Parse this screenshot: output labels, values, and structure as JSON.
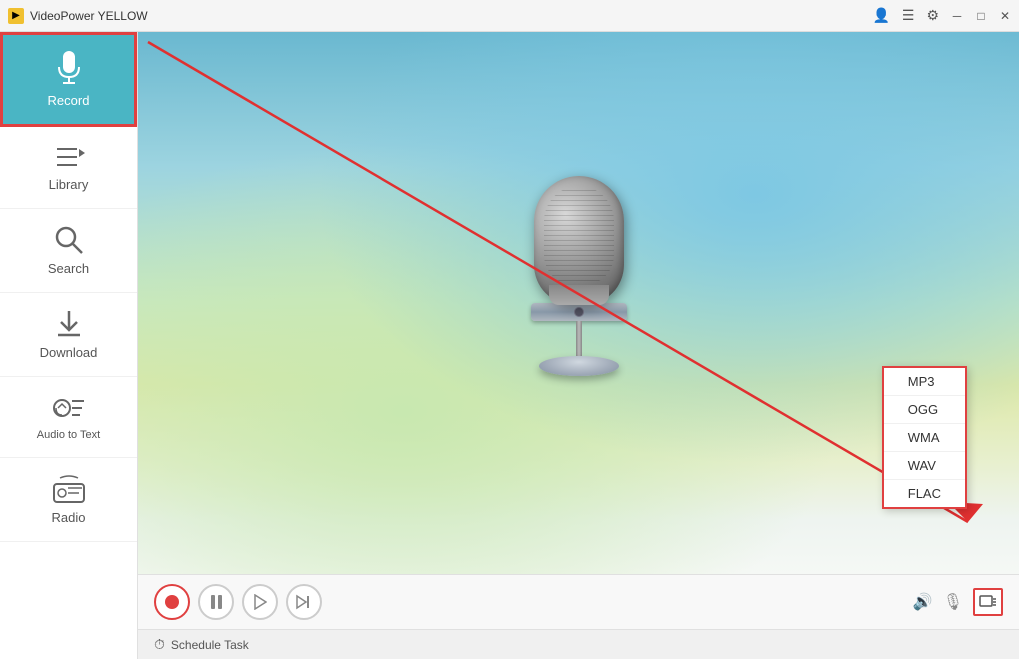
{
  "app": {
    "title": "VideoPower YELLOW"
  },
  "sidebar": {
    "items": [
      {
        "id": "record",
        "label": "Record",
        "icon": "🎙",
        "active": true
      },
      {
        "id": "library",
        "label": "Library",
        "icon": "≡♪",
        "active": false
      },
      {
        "id": "search",
        "label": "Search",
        "icon": "🔍",
        "active": false
      },
      {
        "id": "download",
        "label": "Download",
        "icon": "⬇",
        "active": false
      },
      {
        "id": "audio-to-text",
        "label": "Audio to Text",
        "icon": "◀)",
        "active": false
      },
      {
        "id": "radio",
        "label": "Radio",
        "icon": "📻",
        "active": false
      }
    ]
  },
  "format_popup": {
    "items": [
      "MP3",
      "OGG",
      "WMA",
      "WAV",
      "FLAC"
    ]
  },
  "player": {
    "controls": [
      "record",
      "pause",
      "play",
      "next"
    ],
    "icons_right": [
      "volume",
      "mic",
      "format"
    ]
  },
  "schedule": {
    "label": "Schedule Task"
  },
  "titlebar": {
    "icons": [
      "user",
      "list",
      "settings",
      "minimize",
      "restore",
      "close"
    ]
  }
}
